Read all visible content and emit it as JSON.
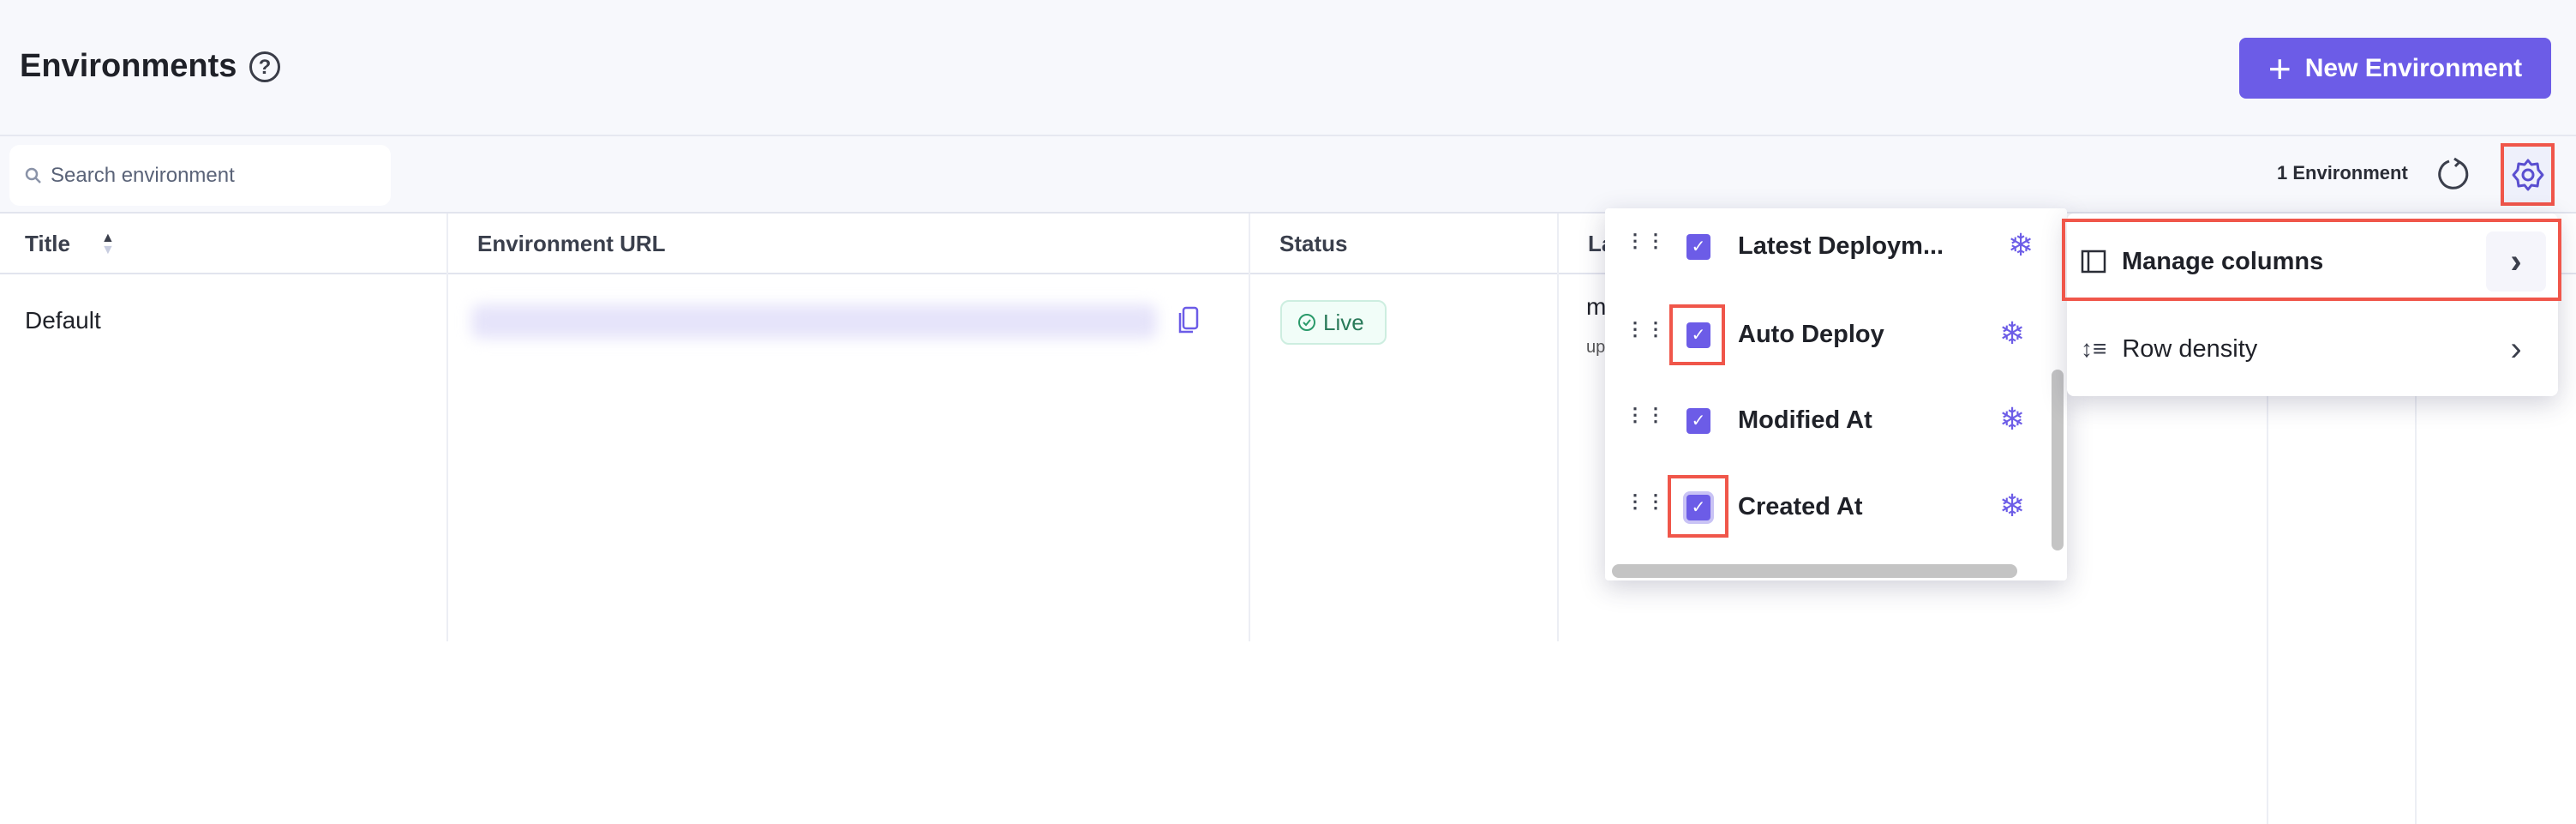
{
  "header": {
    "title": "Environments",
    "help_icon": "?",
    "new_button": "New Environment",
    "plus_icon": "+"
  },
  "toolbar": {
    "search_placeholder": "Search environment",
    "count": "1 Environment"
  },
  "table": {
    "columns": [
      "Title",
      "Environment URL",
      "Status",
      "La"
    ],
    "rows": [
      {
        "title": "Default",
        "status": "Live",
        "latest_partial": "m",
        "latest_sub_partial": "up"
      }
    ]
  },
  "columns_menu": {
    "items": [
      {
        "label": "Latest Deploym...",
        "checked": true
      },
      {
        "label": "Auto Deploy",
        "checked": true
      },
      {
        "label": "Modified At",
        "checked": true
      },
      {
        "label": "Created At",
        "checked": true
      }
    ]
  },
  "settings_menu": {
    "items": [
      {
        "label": "Manage columns"
      },
      {
        "label": "Row density"
      }
    ]
  },
  "colors": {
    "accent": "#6c5ce7",
    "highlight": "#f0564a"
  }
}
